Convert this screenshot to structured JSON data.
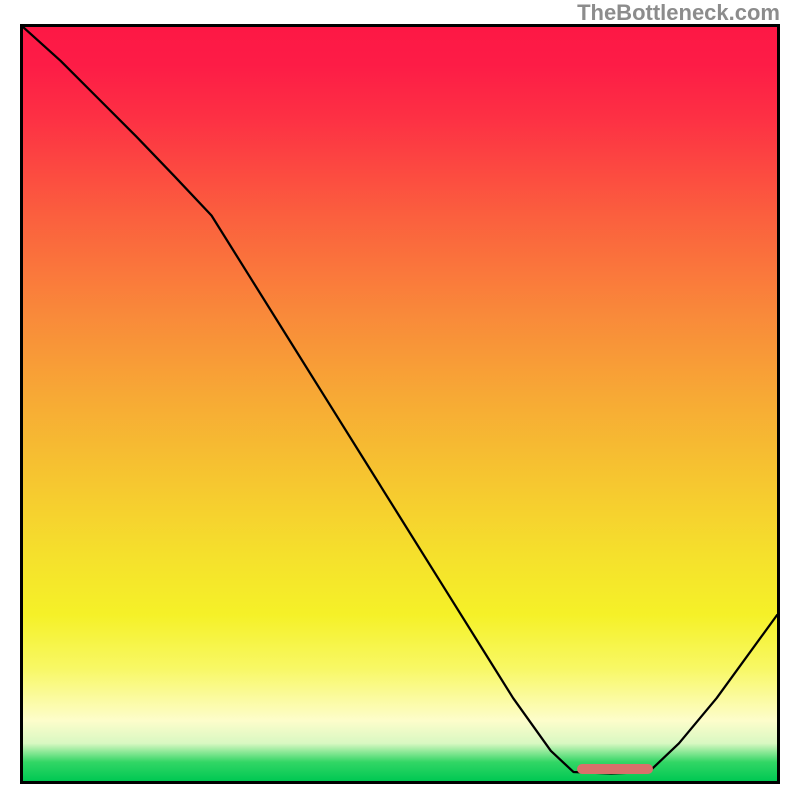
{
  "watermark": "TheBottleneck.com",
  "colors": {
    "curve": "#000000",
    "slider": "#d9706b"
  },
  "slider": {
    "left_frac": 0.735,
    "width_frac": 0.1,
    "bottom_frac": 0.985
  },
  "chart_data": {
    "type": "line",
    "title": "",
    "xlabel": "",
    "ylabel": "",
    "xlim": [
      0,
      1
    ],
    "ylim": [
      0,
      1
    ],
    "note": "Values are fractional coordinates within the plot rectangle: x from left (0→1) and y as height above bottom (0=baseline, 1=top). The line starts at top-left, descends (with a slope break around x≈0.25), reaches a flat bottom near x≈0.73–0.83, then rises toward the right edge.",
    "series": [
      {
        "name": "curve",
        "x": [
          0.0,
          0.05,
          0.1,
          0.15,
          0.2,
          0.25,
          0.3,
          0.35,
          0.4,
          0.45,
          0.5,
          0.55,
          0.6,
          0.65,
          0.7,
          0.73,
          0.78,
          0.83,
          0.87,
          0.92,
          1.0
        ],
        "y": [
          1.0,
          0.955,
          0.905,
          0.855,
          0.803,
          0.75,
          0.67,
          0.59,
          0.51,
          0.43,
          0.35,
          0.27,
          0.19,
          0.11,
          0.04,
          0.012,
          0.01,
          0.012,
          0.05,
          0.11,
          0.22
        ]
      }
    ]
  }
}
